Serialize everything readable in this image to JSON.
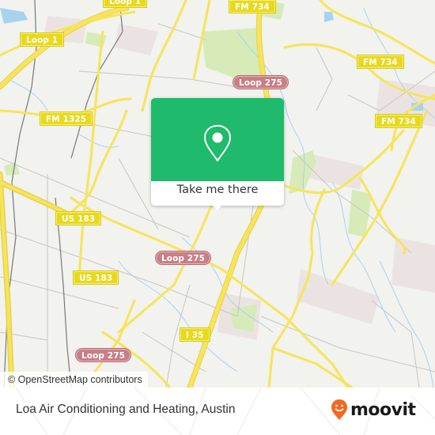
{
  "map": {
    "attribution": "© OpenStreetMap contributors",
    "colors": {
      "background": "#f2f2ef",
      "major_road": "#f7e45a",
      "minor_road": "#c9c6c2",
      "water": "#a8d3ee",
      "park": "#d7ebb9",
      "industrial": "#ebe3e2",
      "rail": "#777777"
    },
    "road_labels": [
      {
        "text": "Loop 1",
        "style": "yellow"
      },
      {
        "text": "Loop 1",
        "style": "yellow"
      },
      {
        "text": "FM 734",
        "style": "yellow"
      },
      {
        "text": "FM 734",
        "style": "yellow"
      },
      {
        "text": "FM 734",
        "style": "yellow"
      },
      {
        "text": "Loop 275",
        "style": "loop"
      },
      {
        "text": "FM 1325",
        "style": "yellow"
      },
      {
        "text": "US 183",
        "style": "yellow"
      },
      {
        "text": "US 183",
        "style": "yellow"
      },
      {
        "text": "Loop 275",
        "style": "loop"
      },
      {
        "text": "I 35",
        "style": "yellow"
      },
      {
        "text": "Loop 275",
        "style": "loop"
      }
    ]
  },
  "popup": {
    "button_label": "Take me there",
    "icon": "map-pin-icon",
    "color": "#1fba6b"
  },
  "footer": {
    "place_name": "Loa Air Conditioning and Heating, Austin",
    "brand": "moovit",
    "brand_color": "#f06a24"
  }
}
